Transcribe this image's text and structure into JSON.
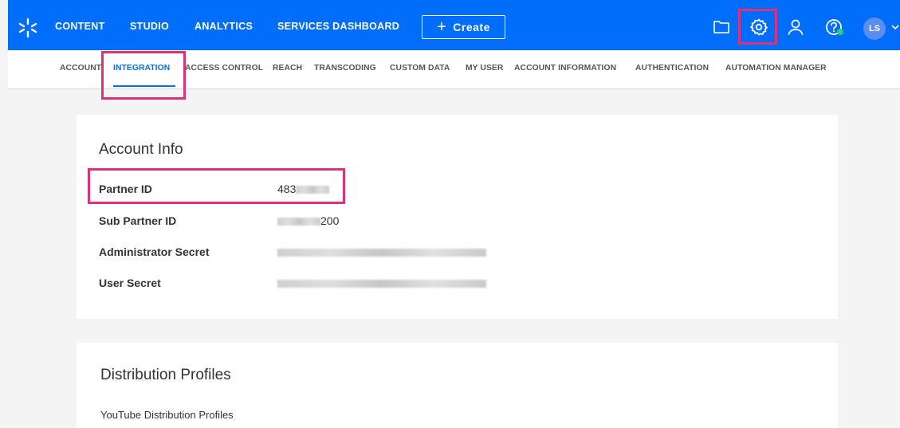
{
  "topnav": {
    "items": [
      "CONTENT",
      "STUDIO",
      "ANALYTICS",
      "SERVICES DASHBOARD"
    ],
    "create_label": "Create",
    "avatar_initials": "LS"
  },
  "subnav": {
    "items": [
      "ACCOUNT",
      "INTEGRATION",
      "ACCESS CONTROL",
      "REACH",
      "TRANSCODING",
      "CUSTOM DATA",
      "MY USER",
      "ACCOUNT INFORMATION",
      "AUTHENTICATION",
      "AUTOMATION MANAGER"
    ],
    "active": "INTEGRATION"
  },
  "account_info": {
    "title": "Account Info",
    "rows": [
      {
        "label": "Partner ID",
        "value": "483"
      },
      {
        "label": "Sub Partner ID",
        "value": "200"
      },
      {
        "label": "Administrator Secret",
        "value": ""
      },
      {
        "label": "User Secret",
        "value": ""
      }
    ]
  },
  "distribution": {
    "title": "Distribution Profiles",
    "youtube_label": "YouTube Distribution Profiles"
  },
  "colors": {
    "brand": "#006efa",
    "highlight": "#e0307a",
    "status_online": "#2ecc71"
  },
  "icons": [
    "kaltura-logo-icon",
    "folder-icon",
    "gear-icon",
    "user-icon",
    "help-icon",
    "chevron-down-icon"
  ]
}
